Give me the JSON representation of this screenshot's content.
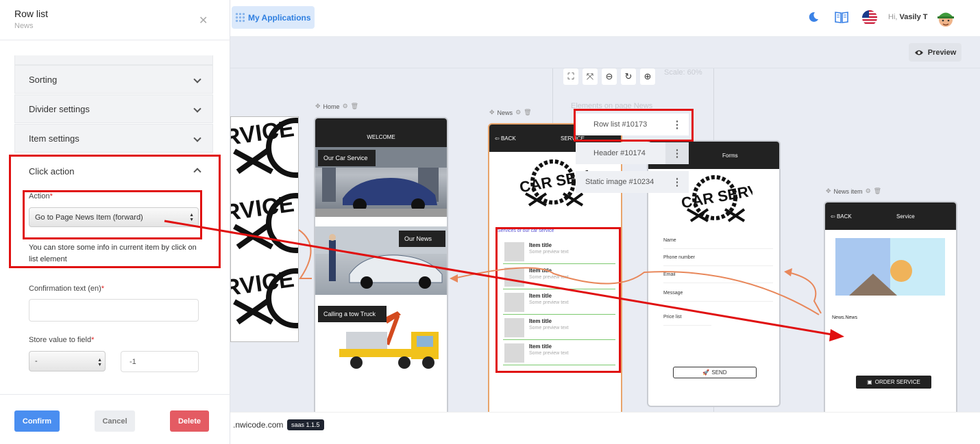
{
  "topbar": {
    "my_applications": "My Applications",
    "greeting": "Hi,",
    "user_name": "Vasily T"
  },
  "canvas": {
    "preview_label": "Preview",
    "scale_label": "Scale: 60%",
    "elements_heading": "Elements on page News",
    "elements": [
      {
        "label": "Row list #10173"
      },
      {
        "label": "Header #10174"
      },
      {
        "label": "Static image #10234"
      }
    ],
    "pages": {
      "home": {
        "label": "Home",
        "header": "WELCOME",
        "tiles": [
          "Our Car Service",
          "Our News",
          "Calling a tow Truck"
        ]
      },
      "news": {
        "label": "News",
        "back": "BACK",
        "title": "SERVICE",
        "list_heading": "Services of our car service",
        "items": [
          {
            "title": "Item title",
            "preview": "Some preview text"
          },
          {
            "title": "Item title",
            "preview": "Some preview text"
          },
          {
            "title": "Item title",
            "preview": "Some preview text"
          },
          {
            "title": "Item title",
            "preview": "Some preview text"
          },
          {
            "title": "Item title",
            "preview": "Some preview text"
          }
        ]
      },
      "forms": {
        "header": "Forms",
        "fields": [
          "Name",
          "Phone number",
          "Email",
          "Message",
          "Price list"
        ],
        "send_label": "SEND"
      },
      "news_item": {
        "label": "News item",
        "back": "BACK",
        "title": "Service",
        "body_text": "News.News",
        "order_label": "ORDER SERVICE"
      }
    },
    "footer_site": ".nwicode.com",
    "version": "saas 1.1.5"
  },
  "panel": {
    "title": "Row list",
    "subtitle": "News",
    "sections": {
      "sorting": "Sorting",
      "divider": "Divider settings",
      "item": "Item settings",
      "click_action": "Click action"
    },
    "action_label": "Action",
    "action_value": "Go to Page News Item (forward)",
    "help_text": "You can store some info in current item by click on list element",
    "confirmation_label": "Confirmation text (en)",
    "confirmation_value": "",
    "store_label": "Store value to field",
    "store_select": "-",
    "store_value": "-1",
    "confirm_label": "Confirm",
    "cancel_label": "Cancel",
    "delete_label": "Delete"
  },
  "colors": {
    "accent": "#4a8ef0",
    "annotation": "#e01010",
    "connector": "#e8875a",
    "delete": "#e45b63"
  }
}
